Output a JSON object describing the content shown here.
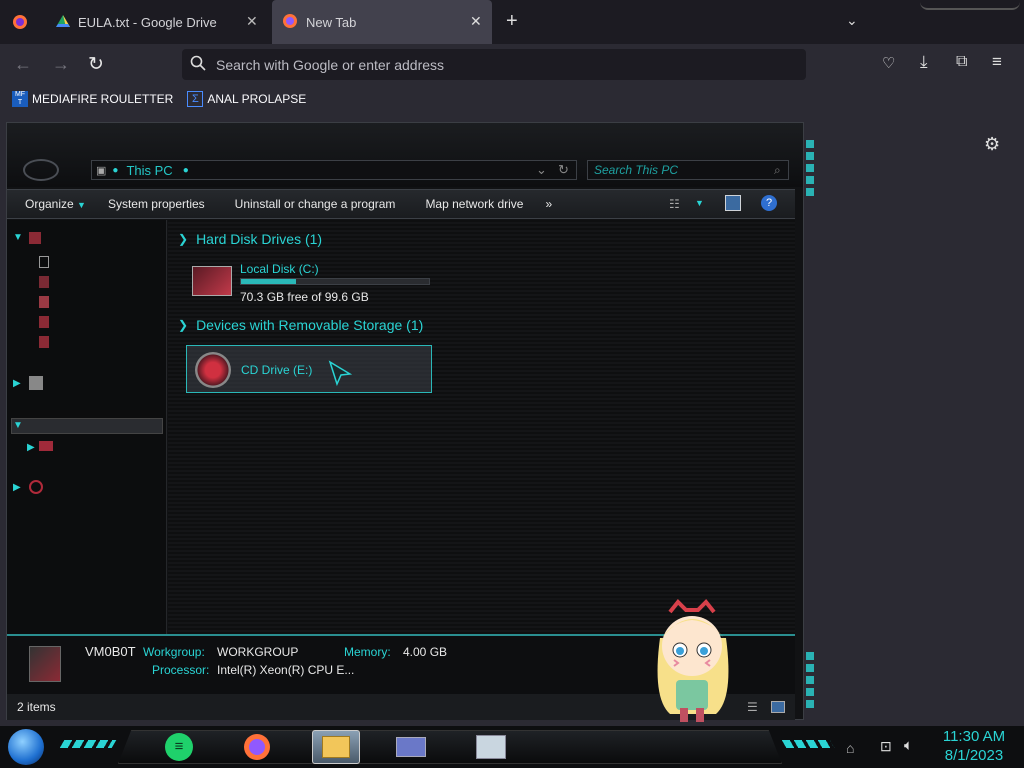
{
  "browser": {
    "tabs": [
      {
        "label": "EULA.txt - Google Drive",
        "icon": "google-drive-icon"
      },
      {
        "label": "New Tab",
        "icon": "firefox-icon"
      }
    ],
    "urlbar_placeholder": "Search with Google or enter address",
    "bookmarks": [
      {
        "label": "MEDIAFIRE ROULETTER",
        "icon": "mediafire-icon"
      },
      {
        "label": "ANAL PROLAPSE",
        "icon": "bookmark-icon"
      }
    ]
  },
  "explorer": {
    "address": "This PC",
    "search_placeholder": "Search This PC",
    "commands": [
      "Organize",
      "System properties",
      "Uninstall or change a program",
      "Map network drive",
      "»"
    ],
    "groups": [
      {
        "title": "Hard Disk Drives (1)",
        "items": [
          {
            "name": "Local Disk (C:)",
            "free_text": "70.3 GB free of 99.6 GB",
            "used_fraction": 0.294
          }
        ]
      },
      {
        "title": "Devices with Removable Storage (1)",
        "items": [
          {
            "name": "CD Drive (E:)"
          }
        ]
      }
    ],
    "details": {
      "computer_name": "VM0B0T",
      "workgroup_label": "Workgroup:",
      "workgroup": "WORKGROUP",
      "memory_label": "Memory:",
      "memory": "4.00 GB",
      "processor_label": "Processor:",
      "processor": "Intel(R) Xeon(R) CPU E..."
    },
    "status": "2 items"
  },
  "taskbar": {
    "time": "11:30 AM",
    "date": "8/1/2023"
  },
  "colors": {
    "accent": "#2ad4d4",
    "browser_bg": "#2b2a33",
    "explorer_bg": "#111214"
  }
}
